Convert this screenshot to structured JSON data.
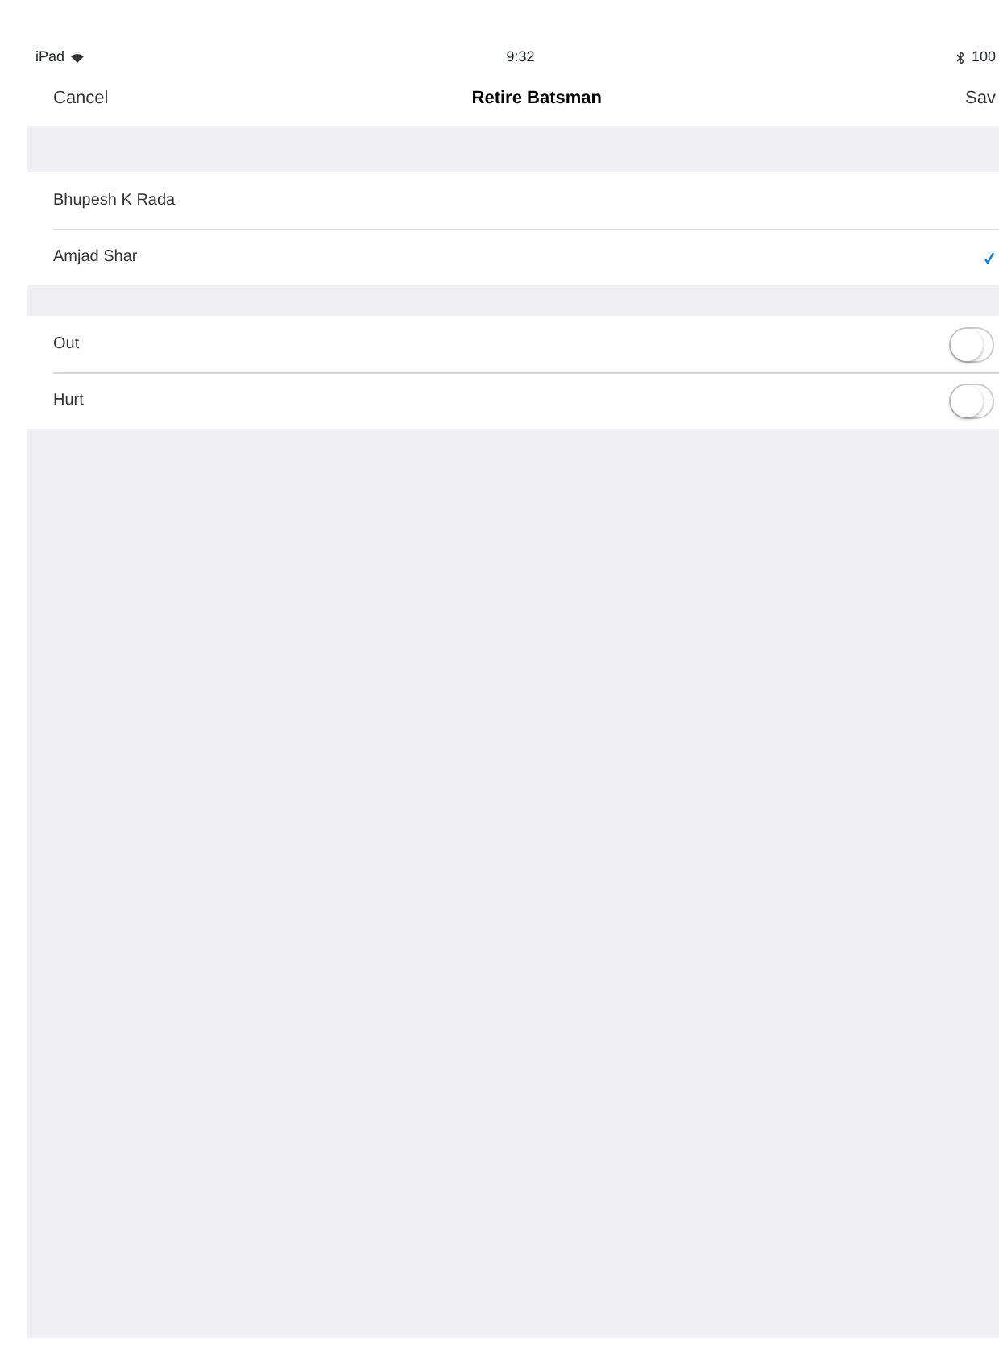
{
  "status_bar": {
    "device": "iPad",
    "time": "9:32",
    "battery": "100"
  },
  "nav": {
    "cancel": "Cancel",
    "title": "Retire Batsman",
    "save": "Sav"
  },
  "batsmen": [
    {
      "name": "Bhupesh K Rada",
      "selected": false
    },
    {
      "name": "Amjad Shar",
      "selected": true
    }
  ],
  "options": [
    {
      "label": "Out",
      "on": false
    },
    {
      "label": "Hurt",
      "on": false
    }
  ]
}
